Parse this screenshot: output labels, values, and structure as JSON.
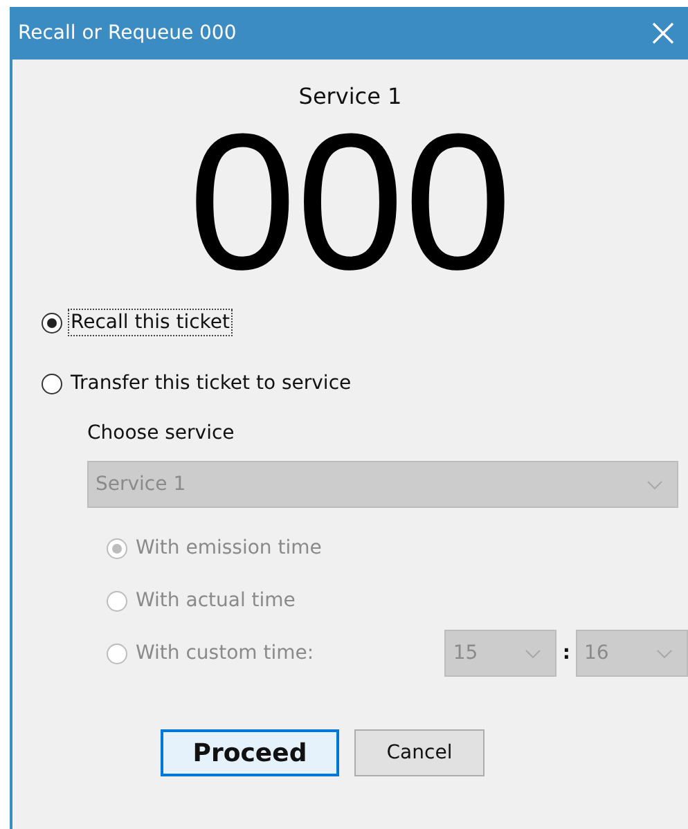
{
  "window": {
    "title": "Recall or Requeue 000"
  },
  "service_name": "Service 1",
  "ticket_number": "000",
  "options": [
    {
      "label": "Recall this ticket",
      "selected": true,
      "focused": true
    },
    {
      "label": "Transfer this ticket to service",
      "selected": false,
      "focused": false
    }
  ],
  "transfer": {
    "label": "Choose service",
    "disabled": true,
    "service": "Service 1",
    "time_options": [
      {
        "label": "With emission time",
        "selected": true
      },
      {
        "label": "With actual time",
        "selected": false
      },
      {
        "label": "With custom time:",
        "selected": false
      }
    ],
    "hour": "15",
    "separator": ":",
    "minute": "16"
  },
  "buttons": [
    {
      "label": "Proceed",
      "default": true
    },
    {
      "label": "Cancel",
      "default": false
    }
  ]
}
